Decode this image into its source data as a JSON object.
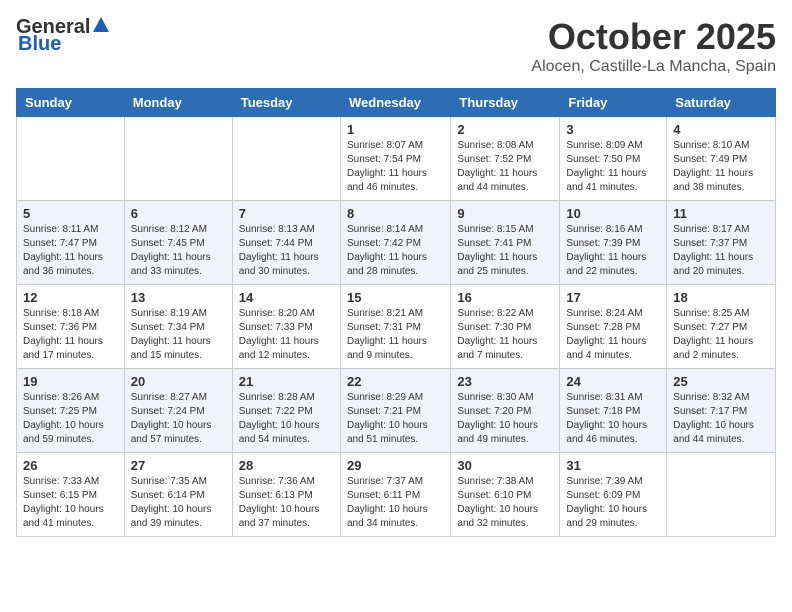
{
  "header": {
    "logo": {
      "general": "General",
      "blue": "Blue"
    },
    "title": "October 2025",
    "location": "Alocen, Castille-La Mancha, Spain"
  },
  "calendar": {
    "days_of_week": [
      "Sunday",
      "Monday",
      "Tuesday",
      "Wednesday",
      "Thursday",
      "Friday",
      "Saturday"
    ],
    "weeks": [
      [
        {
          "day": "",
          "info": ""
        },
        {
          "day": "",
          "info": ""
        },
        {
          "day": "",
          "info": ""
        },
        {
          "day": "1",
          "info": "Sunrise: 8:07 AM\nSunset: 7:54 PM\nDaylight: 11 hours and 46 minutes."
        },
        {
          "day": "2",
          "info": "Sunrise: 8:08 AM\nSunset: 7:52 PM\nDaylight: 11 hours and 44 minutes."
        },
        {
          "day": "3",
          "info": "Sunrise: 8:09 AM\nSunset: 7:50 PM\nDaylight: 11 hours and 41 minutes."
        },
        {
          "day": "4",
          "info": "Sunrise: 8:10 AM\nSunset: 7:49 PM\nDaylight: 11 hours and 38 minutes."
        }
      ],
      [
        {
          "day": "5",
          "info": "Sunrise: 8:11 AM\nSunset: 7:47 PM\nDaylight: 11 hours and 36 minutes."
        },
        {
          "day": "6",
          "info": "Sunrise: 8:12 AM\nSunset: 7:45 PM\nDaylight: 11 hours and 33 minutes."
        },
        {
          "day": "7",
          "info": "Sunrise: 8:13 AM\nSunset: 7:44 PM\nDaylight: 11 hours and 30 minutes."
        },
        {
          "day": "8",
          "info": "Sunrise: 8:14 AM\nSunset: 7:42 PM\nDaylight: 11 hours and 28 minutes."
        },
        {
          "day": "9",
          "info": "Sunrise: 8:15 AM\nSunset: 7:41 PM\nDaylight: 11 hours and 25 minutes."
        },
        {
          "day": "10",
          "info": "Sunrise: 8:16 AM\nSunset: 7:39 PM\nDaylight: 11 hours and 22 minutes."
        },
        {
          "day": "11",
          "info": "Sunrise: 8:17 AM\nSunset: 7:37 PM\nDaylight: 11 hours and 20 minutes."
        }
      ],
      [
        {
          "day": "12",
          "info": "Sunrise: 8:18 AM\nSunset: 7:36 PM\nDaylight: 11 hours and 17 minutes."
        },
        {
          "day": "13",
          "info": "Sunrise: 8:19 AM\nSunset: 7:34 PM\nDaylight: 11 hours and 15 minutes."
        },
        {
          "day": "14",
          "info": "Sunrise: 8:20 AM\nSunset: 7:33 PM\nDaylight: 11 hours and 12 minutes."
        },
        {
          "day": "15",
          "info": "Sunrise: 8:21 AM\nSunset: 7:31 PM\nDaylight: 11 hours and 9 minutes."
        },
        {
          "day": "16",
          "info": "Sunrise: 8:22 AM\nSunset: 7:30 PM\nDaylight: 11 hours and 7 minutes."
        },
        {
          "day": "17",
          "info": "Sunrise: 8:24 AM\nSunset: 7:28 PM\nDaylight: 11 hours and 4 minutes."
        },
        {
          "day": "18",
          "info": "Sunrise: 8:25 AM\nSunset: 7:27 PM\nDaylight: 11 hours and 2 minutes."
        }
      ],
      [
        {
          "day": "19",
          "info": "Sunrise: 8:26 AM\nSunset: 7:25 PM\nDaylight: 10 hours and 59 minutes."
        },
        {
          "day": "20",
          "info": "Sunrise: 8:27 AM\nSunset: 7:24 PM\nDaylight: 10 hours and 57 minutes."
        },
        {
          "day": "21",
          "info": "Sunrise: 8:28 AM\nSunset: 7:22 PM\nDaylight: 10 hours and 54 minutes."
        },
        {
          "day": "22",
          "info": "Sunrise: 8:29 AM\nSunset: 7:21 PM\nDaylight: 10 hours and 51 minutes."
        },
        {
          "day": "23",
          "info": "Sunrise: 8:30 AM\nSunset: 7:20 PM\nDaylight: 10 hours and 49 minutes."
        },
        {
          "day": "24",
          "info": "Sunrise: 8:31 AM\nSunset: 7:18 PM\nDaylight: 10 hours and 46 minutes."
        },
        {
          "day": "25",
          "info": "Sunrise: 8:32 AM\nSunset: 7:17 PM\nDaylight: 10 hours and 44 minutes."
        }
      ],
      [
        {
          "day": "26",
          "info": "Sunrise: 7:33 AM\nSunset: 6:15 PM\nDaylight: 10 hours and 41 minutes."
        },
        {
          "day": "27",
          "info": "Sunrise: 7:35 AM\nSunset: 6:14 PM\nDaylight: 10 hours and 39 minutes."
        },
        {
          "day": "28",
          "info": "Sunrise: 7:36 AM\nSunset: 6:13 PM\nDaylight: 10 hours and 37 minutes."
        },
        {
          "day": "29",
          "info": "Sunrise: 7:37 AM\nSunset: 6:11 PM\nDaylight: 10 hours and 34 minutes."
        },
        {
          "day": "30",
          "info": "Sunrise: 7:38 AM\nSunset: 6:10 PM\nDaylight: 10 hours and 32 minutes."
        },
        {
          "day": "31",
          "info": "Sunrise: 7:39 AM\nSunset: 6:09 PM\nDaylight: 10 hours and 29 minutes."
        },
        {
          "day": "",
          "info": ""
        }
      ]
    ]
  }
}
